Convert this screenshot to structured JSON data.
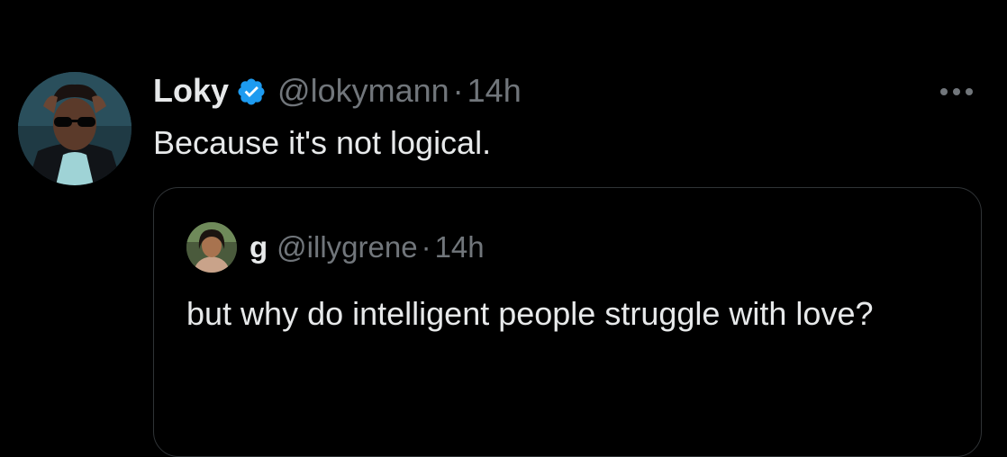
{
  "tweet": {
    "display_name": "Loky",
    "handle": "@lokymann",
    "separator": "·",
    "time": "14h",
    "text": "Because it's not logical.",
    "verified": true,
    "more_icon": "more-horizontal-icon"
  },
  "quoted_tweet": {
    "display_name": "g",
    "handle": "@illygrene",
    "separator": "·",
    "time": "14h",
    "text": "but why do intelligent people struggle with love?"
  },
  "colors": {
    "background": "#000000",
    "primary_text": "#e7e9ea",
    "secondary_text": "#71767b",
    "verified_blue": "#1d9bf0",
    "border": "#2f3336"
  }
}
